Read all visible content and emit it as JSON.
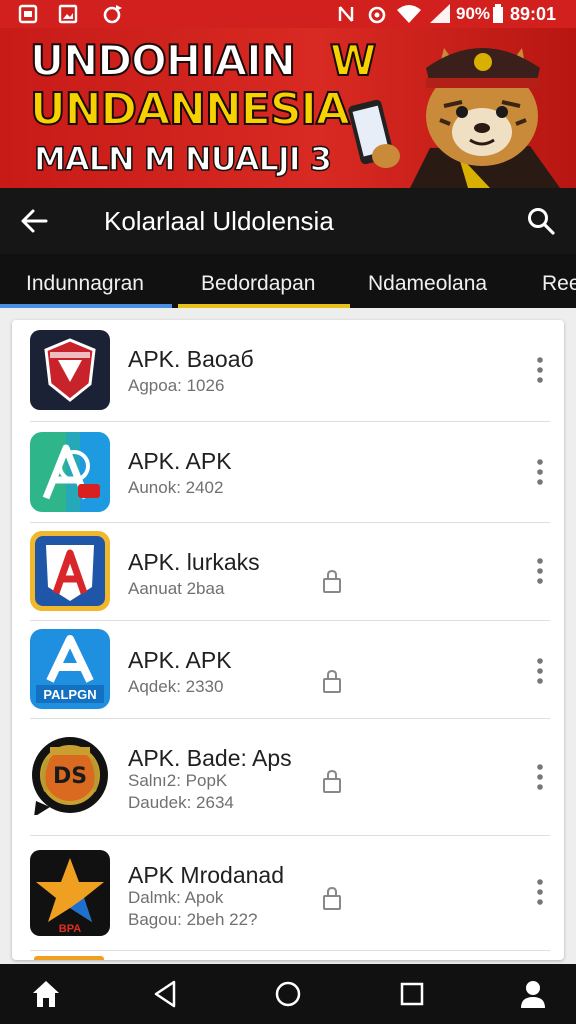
{
  "status_bar": {
    "battery": "90%",
    "time": "89:01"
  },
  "banner": {
    "line1": "UNDOHIAIN",
    "line1_w": "W",
    "line2": "UNDANNESIA",
    "line3": "MALN M NUALJI 3"
  },
  "app_bar": {
    "title": "Kolarlaal Uldolensia"
  },
  "tabs": [
    {
      "label": "Indunnagran",
      "active_color": "#4a90e2"
    },
    {
      "label": "Bedordapan",
      "active_color": "#e8c21a"
    },
    {
      "label": "Ndameolana"
    },
    {
      "label": "Ree"
    }
  ],
  "apps": [
    {
      "name": "APK. Baoaб",
      "sub1": "Agpoa: 1026",
      "sub2": "",
      "icon": "shield-emblem-icon",
      "lock": false
    },
    {
      "name": "APK. APK",
      "sub1": "Aunok: 2402",
      "sub2": "",
      "icon": "letter-a-green-icon",
      "lock": false
    },
    {
      "name": "APK. lurkaks",
      "sub1": "Aanuat 2baa",
      "sub2": "",
      "icon": "letter-a-shield-icon",
      "lock": true
    },
    {
      "name": "APK. APK",
      "sub1": "Aqdek: 2330",
      "sub2": "",
      "icon": "letter-a-blue-icon",
      "lock": true
    },
    {
      "name": "APK. Bade: Aps",
      "sub1": "Salnı2: PopK",
      "sub2": "Daudek: 2634",
      "icon": "laurel-badge-icon",
      "lock": true
    },
    {
      "name": "APK Mrodanad",
      "sub1": "Dalmk: Apok",
      "sub2": "Bagou: 2beh 22?",
      "icon": "star-icon",
      "lock": true
    }
  ],
  "colors": {
    "banner_red": "#d2201e",
    "accent_yellow": "#f5d200",
    "tab_blue": "#4a90e2",
    "tab_yellow": "#e8c21a"
  }
}
